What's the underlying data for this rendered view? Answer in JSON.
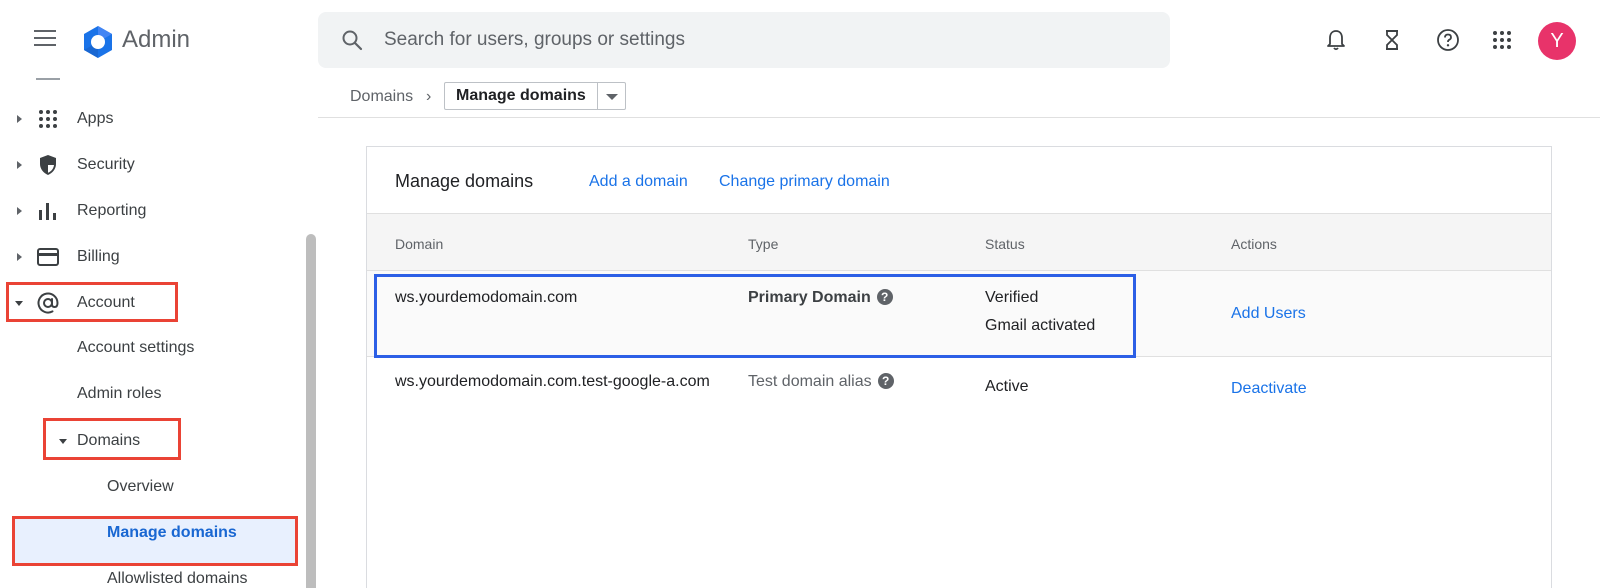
{
  "app": {
    "title": "Admin"
  },
  "search": {
    "placeholder": "Search for users, groups or settings"
  },
  "toolbar": {
    "icons": [
      "notifications-icon",
      "hourglass-icon",
      "help-icon",
      "apps-grid-icon"
    ],
    "avatar_letter": "Y",
    "avatar_color": "#e8336a"
  },
  "sidebar": {
    "items": [
      {
        "label": "Apps",
        "icon": "apps-grid-icon"
      },
      {
        "label": "Security",
        "icon": "shield-icon"
      },
      {
        "label": "Reporting",
        "icon": "bar-chart-icon"
      },
      {
        "label": "Billing",
        "icon": "credit-card-icon"
      },
      {
        "label": "Account",
        "icon": "at-sign-icon",
        "expanded": true
      }
    ],
    "account_children": [
      "Account settings",
      "Admin roles",
      "Domains"
    ],
    "domains_children": [
      "Overview",
      "Manage domains",
      "Allowlisted domains"
    ],
    "active_item": "Manage domains"
  },
  "breadcrumb": {
    "parent": "Domains",
    "current": "Manage domains"
  },
  "card": {
    "title": "Manage domains",
    "links": {
      "add_domain": "Add a domain",
      "change_primary": "Change primary domain"
    },
    "headers": {
      "domain": "Domain",
      "type": "Type",
      "status": "Status",
      "actions": "Actions"
    },
    "rows": [
      {
        "domain": "ws.yourdemodomain.com",
        "type": "Primary Domain",
        "status_line1": "Verified",
        "status_line2": "Gmail activated",
        "action": "Add Users"
      },
      {
        "domain": "ws.yourdemodomain.com.test-google-a.com",
        "type": "Test domain alias",
        "status_line1": "Active",
        "action": "Deactivate"
      }
    ]
  },
  "colors": {
    "accent": "#1a73e8",
    "highlight_red": "#ea4335",
    "highlight_blue": "#2c5fe6",
    "active_bg": "#e8f0fe"
  }
}
